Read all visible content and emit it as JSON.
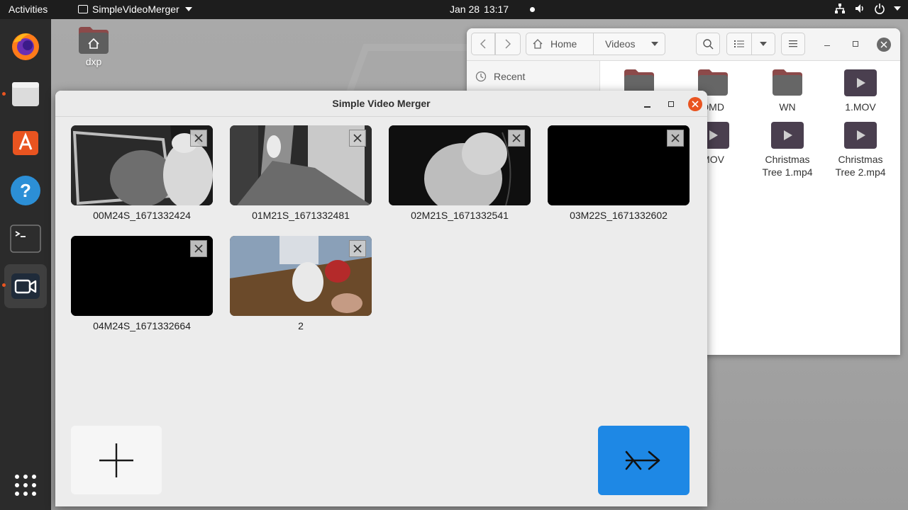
{
  "topbar": {
    "activities": "Activities",
    "app_name": "SimpleVideoMerger",
    "date": "Jan 28",
    "time": "13:17"
  },
  "desktop": {
    "home_icon_label": "dxp"
  },
  "files_window": {
    "path_home": "Home",
    "path_videos": "Videos",
    "sidebar_recent": "Recent",
    "items": [
      {
        "label": "",
        "type": "folder"
      },
      {
        "label": "DMD",
        "type": "folder"
      },
      {
        "label": "WN",
        "type": "folder"
      },
      {
        "label": "1.MOV",
        "type": "video"
      },
      {
        "label": "MOV",
        "type": "video"
      },
      {
        "label": "Christmas Tree 1.mp4",
        "type": "video"
      },
      {
        "label": "Christmas Tree 2.mp4",
        "type": "video"
      }
    ]
  },
  "merger_window": {
    "title": "Simple Video Merger",
    "clips": [
      {
        "name": "00M24S_1671332424"
      },
      {
        "name": "01M21S_1671332481"
      },
      {
        "name": "02M21S_1671332541"
      },
      {
        "name": "03M22S_1671332602"
      },
      {
        "name": "04M24S_1671332664"
      },
      {
        "name": "2"
      }
    ]
  },
  "colors": {
    "accent_blue": "#1e88e5",
    "ubuntu_orange": "#e95420",
    "folder_brown": "#8c5a5a"
  }
}
